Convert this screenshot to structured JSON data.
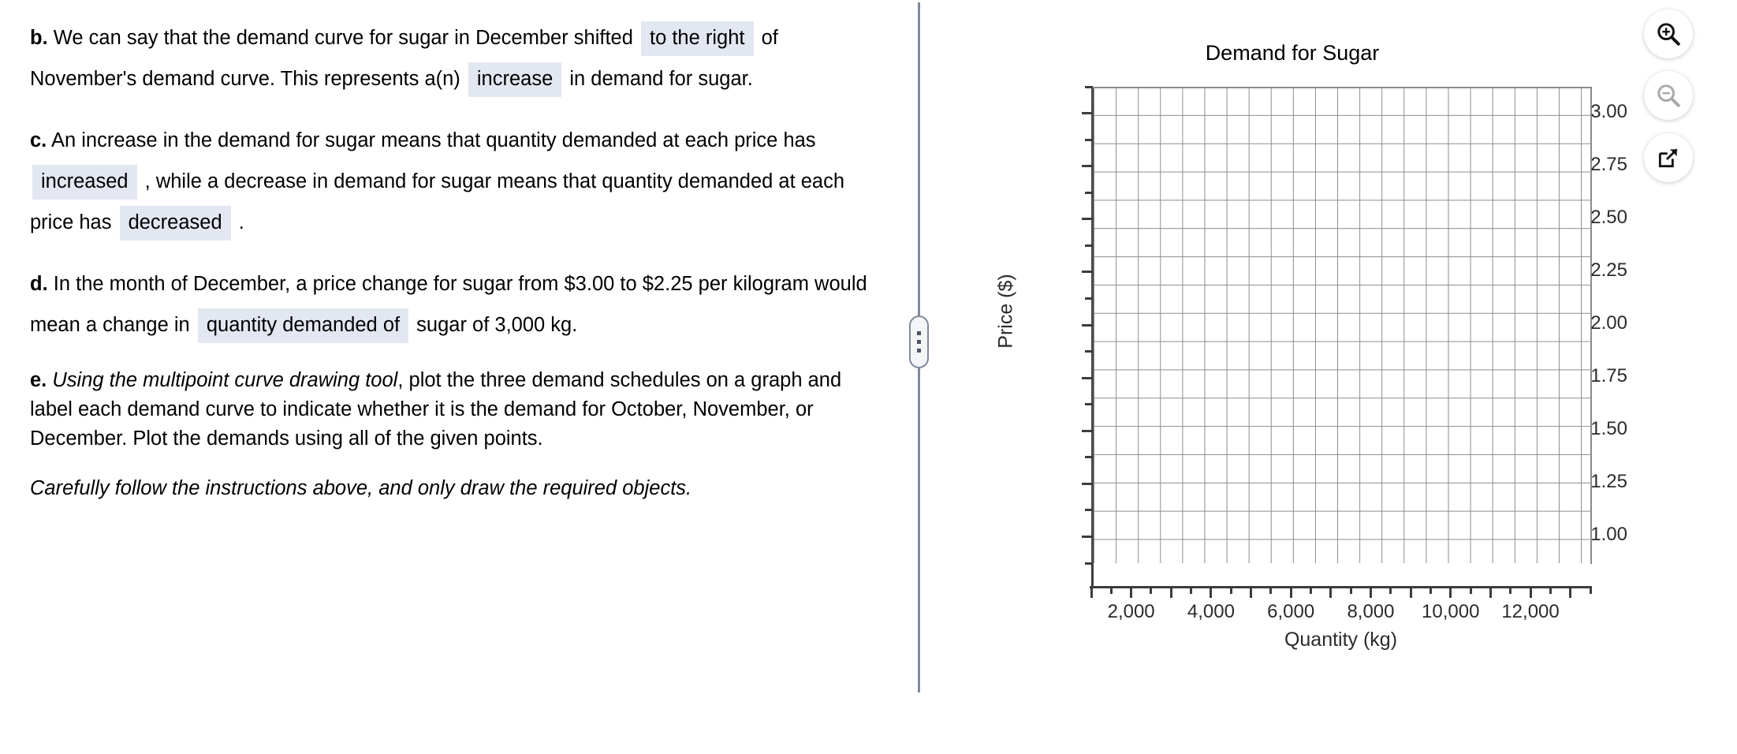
{
  "question": {
    "parts": [
      {
        "id": "b",
        "label": "b.",
        "segments": [
          {
            "type": "text",
            "value": " We can say that the demand curve for sugar in December shifted "
          },
          {
            "type": "blank",
            "value": "to the right"
          },
          {
            "type": "text",
            "value": " of November's demand curve. This represents a(n) "
          },
          {
            "type": "blank",
            "value": "increase"
          },
          {
            "type": "text",
            "value": " in demand for sugar."
          }
        ]
      },
      {
        "id": "c",
        "label": "c.",
        "segments": [
          {
            "type": "text",
            "value": " An increase in the demand for sugar means that quantity demanded at each price has "
          },
          {
            "type": "blank",
            "value": "increased"
          },
          {
            "type": "text",
            "value": " , while a decrease in demand for sugar means that quantity demanded at each price has "
          },
          {
            "type": "blank",
            "value": "decreased"
          },
          {
            "type": "text",
            "value": " ."
          }
        ]
      },
      {
        "id": "d",
        "label": "d.",
        "segments": [
          {
            "type": "text",
            "value": " In the month of December, a price change for sugar from $3.00 to $2.25 per kilogram would mean a change in "
          },
          {
            "type": "blank",
            "value": "quantity demanded of"
          },
          {
            "type": "text",
            "value": " sugar of 3,000 kg."
          }
        ]
      },
      {
        "id": "e",
        "label": "e.",
        "segments": [
          {
            "type": "italic",
            "value": " Using the multipoint curve drawing tool"
          },
          {
            "type": "text",
            "value": ", plot the three demand schedules on a graph and label each demand curve to indicate whether it is the demand for October, November, or December. Plot the demands using all of the given points."
          }
        ]
      }
    ],
    "closing_note": "Carefully follow the instructions above, and only draw the required objects."
  },
  "divider": {
    "name": "resize-handle",
    "dots": 3
  },
  "toolbar": {
    "buttons": [
      {
        "name": "zoom-in-button",
        "icon": "magnifier-plus-icon",
        "state": "enabled",
        "color": "#1a1a1a"
      },
      {
        "name": "zoom-out-button",
        "icon": "magnifier-minus-icon",
        "state": "disabled",
        "color": "#a9a9a9"
      },
      {
        "name": "open-in-new-window-button",
        "icon": "external-link-icon",
        "state": "enabled",
        "color": "#1a1a1a"
      }
    ]
  },
  "chart_data": {
    "type": "line",
    "title": "Demand for Sugar",
    "xlabel": "Quantity (kg)",
    "ylabel": "Price ($)",
    "xlim": [
      1000,
      13500
    ],
    "ylim": [
      0.875,
      3.125
    ],
    "x_tick_labels": [
      "2,000",
      "4,000",
      "6,000",
      "8,000",
      "10,000",
      "12,000"
    ],
    "x_tick_values": [
      2000,
      4000,
      6000,
      8000,
      10000,
      12000
    ],
    "x_minor_step": 500,
    "y_tick_labels": [
      "3.00",
      "2.75",
      "2.50",
      "2.25",
      "2.00",
      "1.75",
      "1.50",
      "1.25",
      "1.00"
    ],
    "y_tick_values": [
      3.0,
      2.75,
      2.5,
      2.25,
      2.0,
      1.75,
      1.5,
      1.25,
      1.0
    ],
    "y_minor_step": 0.125,
    "grid": true,
    "legend": null,
    "series": [],
    "annotations": [],
    "note": "Empty plotting grid awaiting user-drawn demand curves for October, November and December."
  }
}
